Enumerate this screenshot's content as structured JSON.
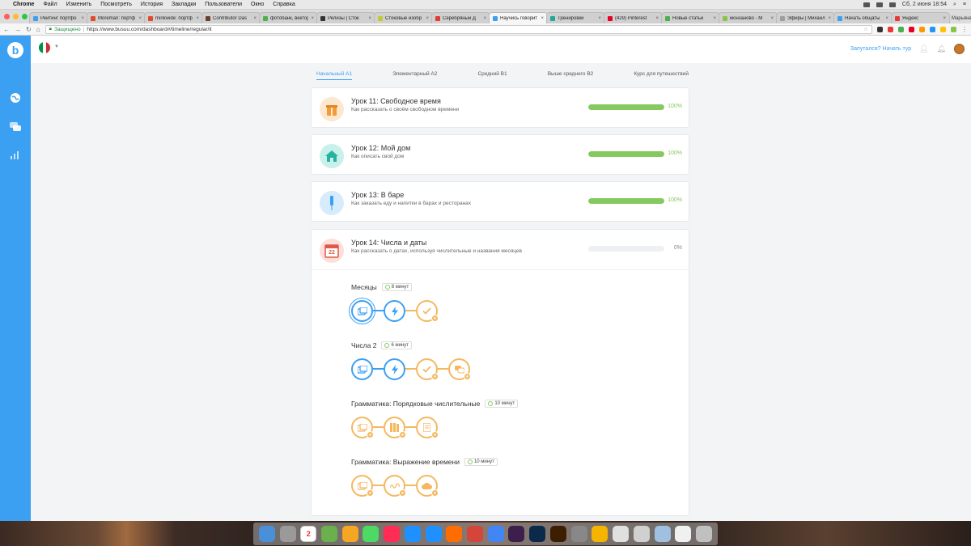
{
  "menubar": {
    "app": "Chrome",
    "items": [
      "Файл",
      "Изменить",
      "Посмотреть",
      "История",
      "Закладки",
      "Пользователи",
      "Окно",
      "Справка"
    ],
    "clock": "Сб, 2 июня  18:54"
  },
  "tabs": [
    {
      "title": "Рейтинг портфо",
      "color": "#3ca0f2",
      "active": false
    },
    {
      "title": "Moreman: портф",
      "color": "#e04a2a",
      "active": false
    },
    {
      "title": "minkwide: портф",
      "color": "#e04a2a",
      "active": false
    },
    {
      "title": "Contributor Das",
      "color": "#6b3f2a",
      "active": false
    },
    {
      "title": "фотобанк, вектор",
      "color": "#4caf50",
      "active": false
    },
    {
      "title": "Релизы | Сток",
      "color": "#333333",
      "active": false
    },
    {
      "title": "Стоковые изобр",
      "color": "#c0ca33",
      "active": false
    },
    {
      "title": "Серебряный Д",
      "color": "#e53935",
      "active": false
    },
    {
      "title": "Научись говорит",
      "color": "#3ca0f2",
      "active": true
    },
    {
      "title": "Тренировки",
      "color": "#26a69a",
      "active": false
    },
    {
      "title": "(429) Pinterest",
      "color": "#e60023",
      "active": false
    },
    {
      "title": "Новые статьи",
      "color": "#4caf50",
      "active": false
    },
    {
      "title": "монзаново - М",
      "color": "#8bc34a",
      "active": false
    },
    {
      "title": "Эфиры | Михаил",
      "color": "#9e9e9e",
      "active": false
    },
    {
      "title": "Начать общаты",
      "color": "#3ca0f2",
      "active": false
    },
    {
      "title": "Яндекс",
      "color": "#e53935",
      "active": false
    }
  ],
  "profile_name": "Марьяна",
  "address": {
    "secure_label": "Защищено",
    "url": "https://www.busuu.com/dashboard#/timeline/regular/it"
  },
  "app": {
    "logo": "b",
    "flag_colors": [
      "#009246",
      "#ffffff",
      "#ce2b37"
    ],
    "tour_link": "Запутался? Начать тур",
    "levels": [
      {
        "label": "Начальный A1",
        "active": true
      },
      {
        "label": "Элементарный A2",
        "active": false
      },
      {
        "label": "Средний B1",
        "active": false
      },
      {
        "label": "Выше среднего B2",
        "active": false
      },
      {
        "label": "Курс для путешествий",
        "active": false
      }
    ],
    "lessons": [
      {
        "title": "Урок 11: Свободное время",
        "subtitle": "Как рассказать о своём свободном времени",
        "progress": 100,
        "progress_label": "100%",
        "icon": "gift-icon",
        "icon_bg": "#fde8cf",
        "icon_color": "#f29b38"
      },
      {
        "title": "Урок 12: Мой дом",
        "subtitle": "Как описать свой дом",
        "progress": 100,
        "progress_label": "100%",
        "icon": "house-icon",
        "icon_bg": "#c9f0ea",
        "icon_color": "#26b3a0"
      },
      {
        "title": "Урок 13: В баре",
        "subtitle": "Как заказать еду и напитки в барах и ресторанах",
        "progress": 100,
        "progress_label": "100%",
        "icon": "syringe-icon",
        "icon_bg": "#d7ecfb",
        "icon_color": "#3ca0f2"
      },
      {
        "title": "Урок 14: Числа и даты",
        "subtitle": "Как рассказать о датах, используя числительные и названия месяцев",
        "progress": 0,
        "progress_label": "0%",
        "icon": "calendar-icon",
        "icon_bg": "#fde0dc",
        "icon_color": "#e05a45",
        "calendar_day": "22"
      }
    ],
    "topics": [
      {
        "title": "Месяцы",
        "duration": "8 минут",
        "nodes": [
          {
            "color": "blue",
            "icon": "cards",
            "ring": true
          },
          {
            "color": "blue",
            "icon": "bolt"
          },
          {
            "color": "orange",
            "icon": "check",
            "badge": true
          }
        ]
      },
      {
        "title": "Числа 2",
        "duration": "6 минут",
        "nodes": [
          {
            "color": "blue",
            "icon": "cards"
          },
          {
            "color": "blue",
            "icon": "bolt"
          },
          {
            "color": "orange",
            "icon": "check",
            "badge": true
          },
          {
            "color": "orange",
            "icon": "chat",
            "badge": true
          }
        ]
      },
      {
        "title": "Грамматика: Порядковые числительные",
        "duration": "10 минут",
        "nodes": [
          {
            "color": "orange",
            "icon": "cards",
            "badge": true
          },
          {
            "color": "orange",
            "icon": "books",
            "badge": true
          },
          {
            "color": "orange",
            "icon": "doc",
            "badge": true
          }
        ]
      },
      {
        "title": "Грамматика: Выражение времени",
        "duration": "10 минут",
        "nodes": [
          {
            "color": "orange",
            "icon": "cards",
            "badge": true
          },
          {
            "color": "orange",
            "icon": "scribble",
            "badge": true
          },
          {
            "color": "orange",
            "icon": "cloud",
            "badge": true
          }
        ]
      }
    ]
  },
  "dock": {
    "calendar_day": "2",
    "apps": [
      "#4a90d9",
      "#9a9a9a",
      "#ffffff",
      "#6ab04c",
      "#f5a623",
      "#4cd964",
      "#ff2d55",
      "#1e90ff",
      "#1e90ff",
      "#ff6d00",
      "#d4453a",
      "#4285f4",
      "#3d1f4d",
      "#0b2a4a",
      "#3d1e00",
      "#888888",
      "#f5b400",
      "#e0e0e0",
      "#d0d0d0",
      "#a0c0e0",
      "#f0f0f0",
      "#c0c0c0"
    ]
  }
}
